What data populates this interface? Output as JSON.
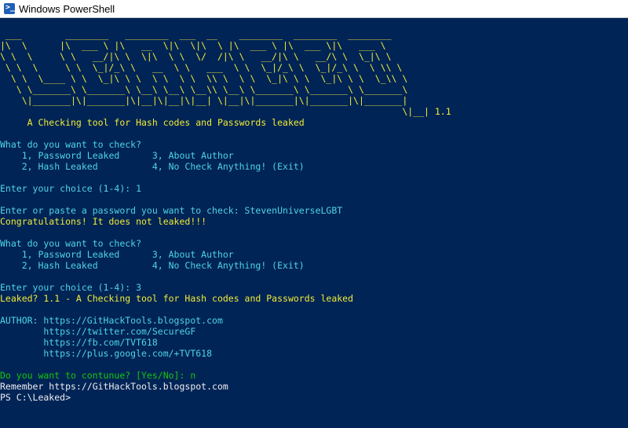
{
  "window": {
    "title": "Windows PowerShell",
    "icon": "powershell-icon"
  },
  "console": {
    "colors": {
      "background": "#012456",
      "yellow": "#f0ec36",
      "cyan": "#4fd4e6",
      "white": "#eeedf0",
      "green": "#16c60c"
    },
    "lines": [
      {
        "text": " ___        ________   ________  ___  __    ________  ________  ________",
        "color": "yellow"
      },
      {
        "text": "|\\  \\      |\\  ___ \\ |\\   __  \\|\\  \\|\\  \\ |\\  ___ \\ |\\  ___ \\|\\   ___ \\",
        "color": "yellow"
      },
      {
        "text": "\\ \\  \\     \\ \\   __/|\\ \\  \\|\\  \\ \\  \\/  /|\\ \\   __/|\\ \\   __/\\ \\  \\_|\\ \\",
        "color": "yellow"
      },
      {
        "text": " \\ \\  \\     \\ \\  \\_|/_\\ \\   __  \\ \\   ___  \\ \\  \\_|/_\\ \\  \\_|/_\\ \\  \\ \\\\ \\",
        "color": "yellow"
      },
      {
        "text": "  \\ \\  \\____ \\ \\  \\_|\\ \\ \\  \\ \\  \\ \\  \\\\ \\  \\ \\  \\_|\\ \\ \\  \\_|\\ \\ \\  \\_\\\\ \\",
        "color": "yellow"
      },
      {
        "text": "   \\ \\_______\\ \\_______\\ \\__\\ \\__\\ \\__\\\\ \\__\\ \\_______\\ \\_______\\ \\_______\\",
        "color": "yellow"
      },
      {
        "text": "    \\|_______|\\|_______|\\|__|\\|__|\\|__| \\|__|\\|_______|\\|_______|\\|_______|",
        "color": "yellow"
      },
      {
        "text": "                                                                          \\|__| 1.1",
        "color": "yellow"
      },
      {
        "text": "     A Checking tool for Hash codes and Passwords leaked",
        "color": "yellow"
      },
      {
        "text": "",
        "color": "white"
      },
      {
        "text": "What do you want to check?",
        "color": "cyan"
      },
      {
        "text": "    1, Password Leaked      3, About Author",
        "color": "cyan"
      },
      {
        "text": "    2, Hash Leaked          4, No Check Anything! (Exit)",
        "color": "cyan"
      },
      {
        "text": "",
        "color": "white"
      },
      {
        "text": "Enter your choice (1-4): 1",
        "color": "cyan"
      },
      {
        "text": "",
        "color": "white"
      },
      {
        "text": "Enter or paste a password you want to check: StevenUniverseLGBT",
        "color": "cyan"
      },
      {
        "text": "Congratulations! It does not leaked!!!",
        "color": "yellow"
      },
      {
        "text": "",
        "color": "white"
      },
      {
        "text": "What do you want to check?",
        "color": "cyan"
      },
      {
        "text": "    1, Password Leaked      3, About Author",
        "color": "cyan"
      },
      {
        "text": "    2, Hash Leaked          4, No Check Anything! (Exit)",
        "color": "cyan"
      },
      {
        "text": "",
        "color": "white"
      },
      {
        "text": "Enter your choice (1-4): 3",
        "color": "cyan"
      },
      {
        "text": "Leaked? 1.1 - A Checking tool for Hash codes and Passwords leaked",
        "color": "yellow"
      },
      {
        "text": "",
        "color": "white"
      },
      {
        "text": "AUTHOR: https://GitHackTools.blogspot.com",
        "color": "cyan"
      },
      {
        "text": "        https://twitter.com/SecureGF",
        "color": "cyan"
      },
      {
        "text": "        https://fb.com/TVT618",
        "color": "cyan"
      },
      {
        "text": "        https://plus.google.com/+TVT618",
        "color": "cyan"
      },
      {
        "text": "",
        "color": "white"
      },
      {
        "text": "Do you want to contunue? [Yes/No]: n",
        "color": "green"
      },
      {
        "text": "Remember https://GitHackTools.blogspot.com",
        "color": "white"
      },
      {
        "text": "PS C:\\Leaked>",
        "color": "white"
      }
    ]
  }
}
